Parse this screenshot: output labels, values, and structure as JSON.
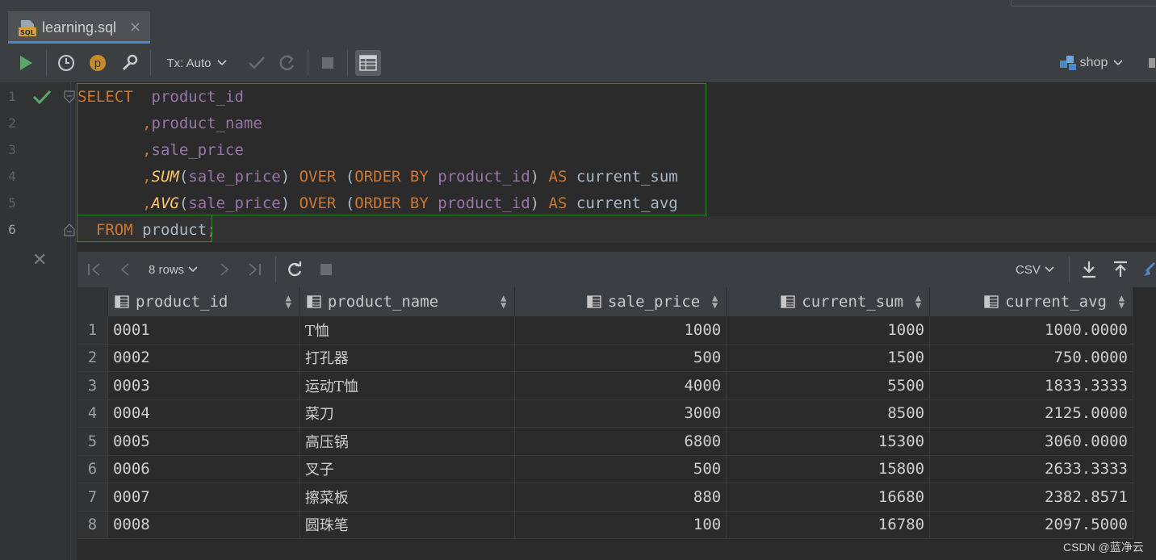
{
  "tab": {
    "title": "learning.sql",
    "close": "×",
    "icon_text": "SQL"
  },
  "toolbar": {
    "tx_mode": "Tx: Auto",
    "datasource": "shop"
  },
  "editor": {
    "line_numbers": [
      "1",
      "2",
      "3",
      "4",
      "5",
      "6"
    ]
  },
  "results": {
    "row_count_label": "8 rows",
    "export_format": "CSV",
    "columns": [
      "product_id",
      "product_name",
      "sale_price",
      "current_sum",
      "current_avg"
    ],
    "rows": [
      [
        "1",
        "0001",
        "T恤",
        "1000",
        "1000",
        "1000.0000"
      ],
      [
        "2",
        "0002",
        "打孔器",
        "500",
        "1500",
        "750.0000"
      ],
      [
        "3",
        "0003",
        "运动T恤",
        "4000",
        "5500",
        "1833.3333"
      ],
      [
        "4",
        "0004",
        "菜刀",
        "3000",
        "8500",
        "2125.0000"
      ],
      [
        "5",
        "0005",
        "高压锅",
        "6800",
        "15300",
        "3060.0000"
      ],
      [
        "6",
        "0006",
        "叉子",
        "500",
        "15800",
        "2633.3333"
      ],
      [
        "7",
        "0007",
        "擦菜板",
        "880",
        "16680",
        "2382.8571"
      ],
      [
        "8",
        "0008",
        "圆珠笔",
        "100",
        "16780",
        "2097.5000"
      ]
    ]
  },
  "watermark": "CSDN @蓝净云",
  "colors": {
    "keyword": "#cc7832",
    "identifier": "#9876aa",
    "function": "#ffc66d",
    "accent": "#4a88c7",
    "run": "#59a869"
  }
}
